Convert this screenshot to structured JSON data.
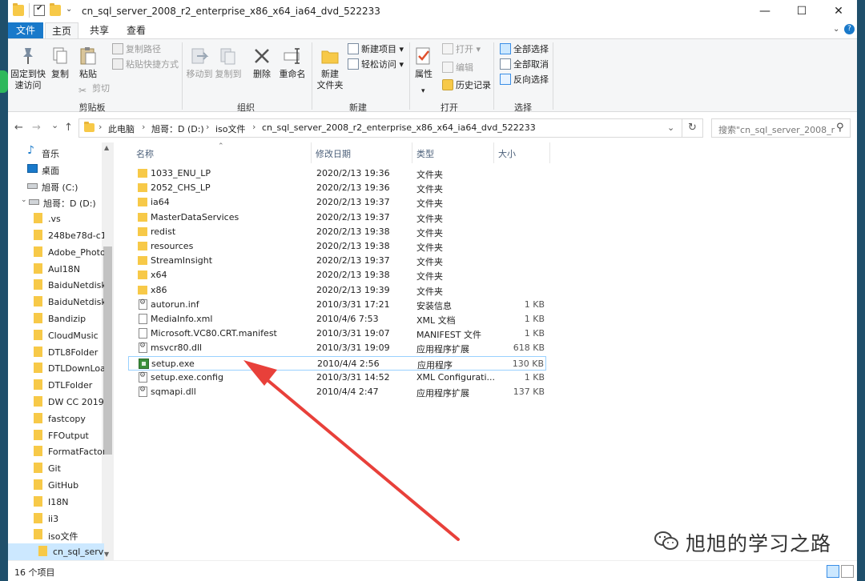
{
  "window": {
    "title": "cn_sql_server_2008_r2_enterprise_x86_x64_ia64_dvd_522233",
    "minimize": "—",
    "maximize": "☐",
    "close": "✕"
  },
  "tabs": [
    {
      "label": "文件"
    },
    {
      "label": "主页"
    },
    {
      "label": "共享"
    },
    {
      "label": "查看"
    }
  ],
  "ribbon": {
    "clipboard": {
      "pin_label_1": "固定到快",
      "pin_label_2": "速访问",
      "copy": "复制",
      "paste": "粘贴",
      "copy_path": "复制路径",
      "paste_shortcut": "粘贴快捷方式",
      "cut": "剪切",
      "group": "剪贴板"
    },
    "organize": {
      "move_to": "移动到",
      "copy_to": "复制到",
      "delete": "删除",
      "rename": "重命名",
      "group": "组织"
    },
    "new": {
      "new_folder_1": "新建",
      "new_folder_2": "文件夹",
      "new_item": "新建项目 ▾",
      "easy_access": "轻松访问 ▾",
      "group": "新建"
    },
    "open": {
      "properties": "属性",
      "open": "打开 ▾",
      "edit": "编辑",
      "history": "历史记录",
      "group": "打开"
    },
    "select": {
      "select_all": "全部选择",
      "select_none": "全部取消",
      "invert": "反向选择",
      "group": "选择"
    }
  },
  "address": {
    "crumbs": [
      "此电脑",
      "旭哥：D (D:)",
      "iso文件",
      "cn_sql_server_2008_r2_enterprise_x86_x64_ia64_dvd_522233"
    ],
    "search_placeholder": "搜索\"cn_sql_server_2008_r2...",
    "back": "←",
    "forward": "→",
    "recent": "⌄",
    "up": "↑",
    "refresh": "↻",
    "dropdown": "⌄"
  },
  "nav": {
    "items": [
      {
        "label": "音乐",
        "icon": "music-icon"
      },
      {
        "label": "桌面",
        "icon": "desktop-icon"
      },
      {
        "label": "旭哥 (C:)",
        "icon": "drive-icon"
      },
      {
        "label": "旭哥：D (D:)",
        "icon": "drive-icon"
      },
      {
        "label": ".vs",
        "icon": "folder-icon"
      },
      {
        "label": "248be78d-c1l",
        "icon": "folder-icon"
      },
      {
        "label": "Adobe_Photo",
        "icon": "folder-icon"
      },
      {
        "label": "AuI18N",
        "icon": "folder-icon"
      },
      {
        "label": "BaiduNetdisk",
        "icon": "folder-icon"
      },
      {
        "label": "BaiduNetdisk",
        "icon": "folder-icon"
      },
      {
        "label": "Bandizip",
        "icon": "folder-icon"
      },
      {
        "label": "CloudMusic",
        "icon": "folder-icon"
      },
      {
        "label": "DTL8Folder",
        "icon": "folder-icon"
      },
      {
        "label": "DTLDownLoa",
        "icon": "folder-icon"
      },
      {
        "label": "DTLFolder",
        "icon": "folder-icon"
      },
      {
        "label": "DW CC 2019",
        "icon": "folder-icon"
      },
      {
        "label": "fastcopy",
        "icon": "folder-icon"
      },
      {
        "label": "FFOutput",
        "icon": "folder-icon"
      },
      {
        "label": "FormatFactor",
        "icon": "folder-icon"
      },
      {
        "label": "Git",
        "icon": "folder-icon"
      },
      {
        "label": "GitHub",
        "icon": "folder-icon"
      },
      {
        "label": "I18N",
        "icon": "folder-icon"
      },
      {
        "label": "ii3",
        "icon": "folder-icon"
      },
      {
        "label": "iso文件",
        "icon": "folder-icon"
      },
      {
        "label": "cn_sql_serve",
        "icon": "folder-icon"
      }
    ]
  },
  "columns": {
    "name": "名称",
    "modified": "修改日期",
    "type": "类型",
    "size": "大小"
  },
  "files": [
    {
      "name": "1033_ENU_LP",
      "modified": "2020/2/13 19:36",
      "type": "文件夹",
      "size": "",
      "kind": "folder"
    },
    {
      "name": "2052_CHS_LP",
      "modified": "2020/2/13 19:36",
      "type": "文件夹",
      "size": "",
      "kind": "folder"
    },
    {
      "name": "ia64",
      "modified": "2020/2/13 19:37",
      "type": "文件夹",
      "size": "",
      "kind": "folder"
    },
    {
      "name": "MasterDataServices",
      "modified": "2020/2/13 19:37",
      "type": "文件夹",
      "size": "",
      "kind": "folder"
    },
    {
      "name": "redist",
      "modified": "2020/2/13 19:38",
      "type": "文件夹",
      "size": "",
      "kind": "folder"
    },
    {
      "name": "resources",
      "modified": "2020/2/13 19:38",
      "type": "文件夹",
      "size": "",
      "kind": "folder"
    },
    {
      "name": "StreamInsight",
      "modified": "2020/2/13 19:37",
      "type": "文件夹",
      "size": "",
      "kind": "folder"
    },
    {
      "name": "x64",
      "modified": "2020/2/13 19:38",
      "type": "文件夹",
      "size": "",
      "kind": "folder"
    },
    {
      "name": "x86",
      "modified": "2020/2/13 19:39",
      "type": "文件夹",
      "size": "",
      "kind": "folder"
    },
    {
      "name": "autorun.inf",
      "modified": "2010/3/31 17:21",
      "type": "安装信息",
      "size": "1 KB",
      "kind": "gear"
    },
    {
      "name": "MediaInfo.xml",
      "modified": "2010/4/6 7:53",
      "type": "XML 文档",
      "size": "1 KB",
      "kind": "file"
    },
    {
      "name": "Microsoft.VC80.CRT.manifest",
      "modified": "2010/3/31 19:07",
      "type": "MANIFEST 文件",
      "size": "1 KB",
      "kind": "file"
    },
    {
      "name": "msvcr80.dll",
      "modified": "2010/3/31 19:09",
      "type": "应用程序扩展",
      "size": "618 KB",
      "kind": "gear"
    },
    {
      "name": "setup.exe",
      "modified": "2010/4/4 2:56",
      "type": "应用程序",
      "size": "130 KB",
      "kind": "exe"
    },
    {
      "name": "setup.exe.config",
      "modified": "2010/3/31 14:52",
      "type": "XML Configurati...",
      "size": "1 KB",
      "kind": "gear"
    },
    {
      "name": "sqmapi.dll",
      "modified": "2010/4/4 2:47",
      "type": "应用程序扩展",
      "size": "137 KB",
      "kind": "gear"
    }
  ],
  "status": {
    "count": "16 个项目"
  },
  "watermark": {
    "text": "旭旭的学习之路"
  },
  "colors": {
    "accent": "#1979ca",
    "folder": "#f7c948",
    "selection": "#cce8ff",
    "arrow": "#e8403a"
  }
}
